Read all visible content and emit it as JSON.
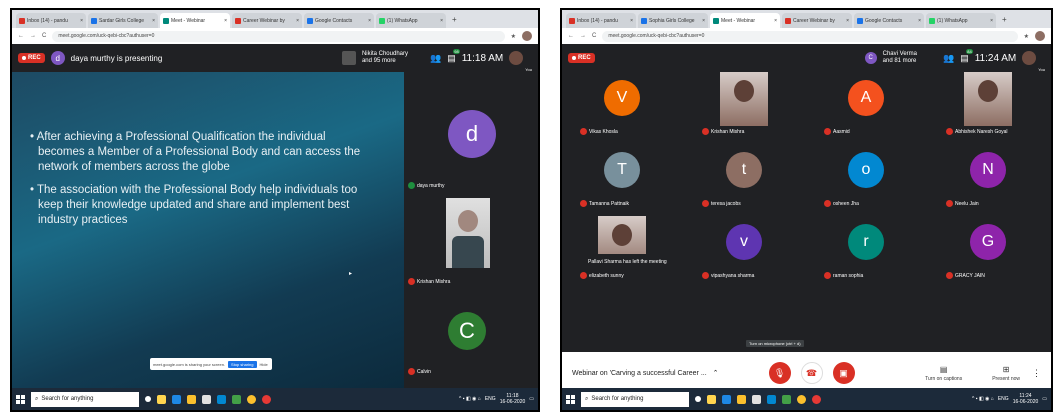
{
  "left": {
    "tabs": [
      {
        "label": "Inbox (14) - pandu",
        "color": "#d93025"
      },
      {
        "label": "Sardar Girls College",
        "color": "#1a73e8"
      },
      {
        "label": "Meet - Webinar",
        "color": "#00897b",
        "active": true
      },
      {
        "label": "Career Webinar by",
        "color": "#d93025"
      },
      {
        "label": "Google Contacts",
        "color": "#1a73e8"
      },
      {
        "label": "(1) WhatsApp",
        "color": "#25d366"
      }
    ],
    "url": "meet.google.com/uck-qebi-cbc?authuser=0",
    "rec_label": "REC",
    "presenter_initial": "d",
    "presenter_text": "daya murthy is presenting",
    "participants_text_1": "Nikita Choudhary",
    "participants_text_2": "and 95 more",
    "people_count": "98",
    "time": "11:18 AM",
    "you_label": "You",
    "slide_bullets": [
      "After achieving a Professional Qualification the individual becomes a Member of a Professional Body and can access the network of members across the globe",
      "The association with the Professional Body help individuals too keep their knowledge updated and share and implement best industry practices"
    ],
    "share_text": "meet.google.com is sharing your screen.",
    "share_stop": "Stop sharing",
    "share_hide": "Hide",
    "side_tiles": [
      {
        "name": "daya murthy",
        "initial": "d",
        "color": "#7e57c2"
      },
      {
        "name": "Krishan Mishra",
        "initial": ""
      },
      {
        "name": "Calvin",
        "initial": "C",
        "color": "#2e7d32"
      }
    ],
    "taskbar_search": "Search for anything",
    "tray_lang": "ENG",
    "tray_time": "11:18",
    "tray_date": "16-06-2020"
  },
  "right": {
    "tabs": [
      {
        "label": "Inbox (14) - pandu",
        "color": "#d93025"
      },
      {
        "label": "Sophia Girls College",
        "color": "#1a73e8"
      },
      {
        "label": "Meet - Webinar",
        "color": "#00897b",
        "active": true
      },
      {
        "label": "Career Webinar by",
        "color": "#d93025"
      },
      {
        "label": "Google Contacts",
        "color": "#1a73e8"
      },
      {
        "label": "(1) WhatsApp",
        "color": "#25d366"
      }
    ],
    "url": "meet.google.com/uck-qebi-cbc?authuser=0",
    "rec_label": "REC",
    "participants_text_1": "Chavi Verma",
    "participants_text_2": "and 81 more",
    "people_count": "84",
    "time": "11:24 AM",
    "you_label": "You",
    "tiles": [
      {
        "name": "Vikas Khosla",
        "initial": "V",
        "color": "#ef6c00"
      },
      {
        "name": "Krishan Mishra",
        "initial": ""
      },
      {
        "name": "Aasmid",
        "initial": "A",
        "color": "#f4511e"
      },
      {
        "name": "Abhishek Naresh Goyal",
        "initial": ""
      },
      {
        "name": "Tamanna Pattnaik",
        "initial": "T",
        "color": "#78909c"
      },
      {
        "name": "teresa jacobs",
        "initial": "t",
        "color": "#8d6e63"
      },
      {
        "name": "osheen Jha",
        "initial": "o",
        "color": "#0288d1"
      },
      {
        "name": "Neelu Jain",
        "initial": "N",
        "color": "#8e24aa"
      },
      {
        "name": "elizabeth sunny",
        "initial": ""
      },
      {
        "name": "vipashyana sharma",
        "initial": "v",
        "color": "#5e35b1"
      },
      {
        "name": "raman sophia",
        "initial": "r",
        "color": "#00897b"
      },
      {
        "name": "GRACY JAIN",
        "initial": "G",
        "color": "#8e24aa"
      }
    ],
    "toast": "Pallavi Sharma has left the meeting",
    "tooltip": "Turn on microphone (ctrl + d)",
    "webinar_title": "Webinar on 'Carving a successful Career ...",
    "captions_label": "Turn on captions",
    "present_label": "Present now",
    "taskbar_search": "Search for anything",
    "tray_lang": "ENG",
    "tray_time": "11:24",
    "tray_date": "16-06-2020"
  }
}
